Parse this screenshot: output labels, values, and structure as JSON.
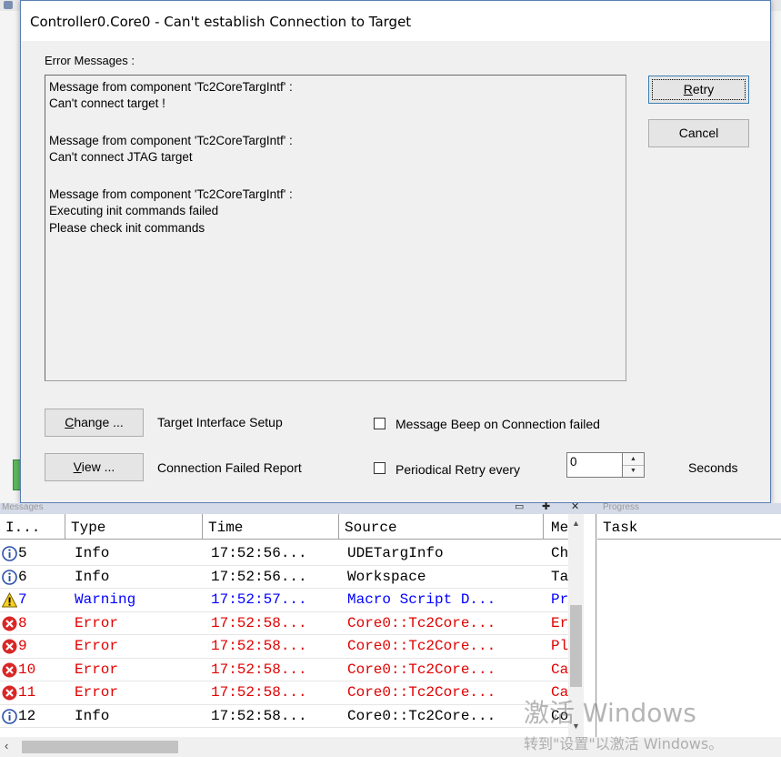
{
  "dialog": {
    "title": "Controller0.Core0 - Can't establish Connection to Target",
    "error_messages_label": "Error Messages :",
    "error_lines": [
      "Message from component 'Tc2CoreTargIntf' :",
      "Can't connect target !",
      "",
      "Message from component 'Tc2CoreTargIntf' :",
      "Can't connect JTAG target",
      "",
      "Message from component 'Tc2CoreTargIntf' :",
      "Executing init commands failed",
      "Please check init commands"
    ],
    "retry_label": "Retry",
    "cancel_label": "Cancel",
    "change_label": "Change ...",
    "change_desc": "Target Interface Setup",
    "view_label": "View ...",
    "view_desc": "Connection Failed Report",
    "beep_label": "Message Beep on Connection failed",
    "beep_checked": false,
    "retry_every_label": "Periodical Retry every",
    "retry_every_checked": false,
    "retry_seconds_value": "0",
    "seconds_label": "Seconds"
  },
  "panes": {
    "messages_title": "Messages",
    "progress_title": "Progress"
  },
  "messages": {
    "columns": [
      "I...",
      "Type",
      "Time",
      "Source",
      "Me"
    ],
    "rows": [
      {
        "id": "5",
        "type": "Info",
        "time": "17:52:56...",
        "source": "UDETargInfo",
        "msg": "Ch",
        "level": "info"
      },
      {
        "id": "6",
        "type": "Info",
        "time": "17:52:56...",
        "source": "Workspace",
        "msg": "Ta",
        "level": "info"
      },
      {
        "id": "7",
        "type": "Warning",
        "time": "17:52:57...",
        "source": "Macro Script D...",
        "msg": "Pr",
        "level": "warning"
      },
      {
        "id": "8",
        "type": "Error",
        "time": "17:52:58...",
        "source": "Core0::Tc2Core...",
        "msg": "Er",
        "level": "error"
      },
      {
        "id": "9",
        "type": "Error",
        "time": "17:52:58...",
        "source": "Core0::Tc2Core...",
        "msg": "Pl",
        "level": "error"
      },
      {
        "id": "10",
        "type": "Error",
        "time": "17:52:58...",
        "source": "Core0::Tc2Core...",
        "msg": "Ca",
        "level": "error"
      },
      {
        "id": "11",
        "type": "Error",
        "time": "17:52:58...",
        "source": "Core0::Tc2Core...",
        "msg": "Ca",
        "level": "error"
      },
      {
        "id": "12",
        "type": "Info",
        "time": "17:52:58...",
        "source": "Core0::Tc2Core...",
        "msg": "Co",
        "level": "info"
      }
    ]
  },
  "progress": {
    "columns": [
      "Task"
    ]
  },
  "watermark": {
    "line1": "激活 Windows",
    "line2": "转到\"设置\"以激活 Windows。"
  },
  "colors": {
    "info_text": "#000000",
    "warning_text": "#0000ff",
    "error_text": "#e00000",
    "dialog_border": "#5a7fb3"
  }
}
